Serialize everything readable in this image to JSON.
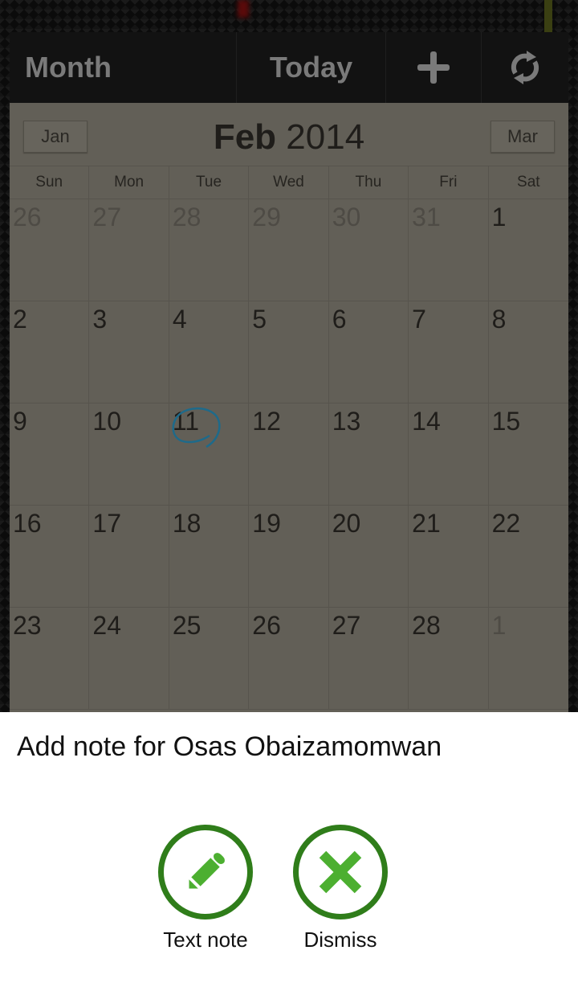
{
  "action_bar": {
    "month_label": "Month",
    "today_label": "Today",
    "add_icon": "plus-icon",
    "sync_icon": "sync-icon"
  },
  "calendar": {
    "prev_month": "Jan",
    "next_month": "Mar",
    "title_month": "Feb",
    "title_year": "2014",
    "weekdays": [
      "Sun",
      "Mon",
      "Tue",
      "Wed",
      "Thu",
      "Fri",
      "Sat"
    ],
    "today": "11",
    "weeks": [
      [
        {
          "d": "26",
          "other": true
        },
        {
          "d": "27",
          "other": true
        },
        {
          "d": "28",
          "other": true
        },
        {
          "d": "29",
          "other": true
        },
        {
          "d": "30",
          "other": true
        },
        {
          "d": "31",
          "other": true
        },
        {
          "d": "1",
          "other": false
        }
      ],
      [
        {
          "d": "2",
          "other": false
        },
        {
          "d": "3",
          "other": false
        },
        {
          "d": "4",
          "other": false
        },
        {
          "d": "5",
          "other": false
        },
        {
          "d": "6",
          "other": false
        },
        {
          "d": "7",
          "other": false
        },
        {
          "d": "8",
          "other": false
        }
      ],
      [
        {
          "d": "9",
          "other": false
        },
        {
          "d": "10",
          "other": false
        },
        {
          "d": "11",
          "other": false
        },
        {
          "d": "12",
          "other": false
        },
        {
          "d": "13",
          "other": false
        },
        {
          "d": "14",
          "other": false
        },
        {
          "d": "15",
          "other": false
        }
      ],
      [
        {
          "d": "16",
          "other": false
        },
        {
          "d": "17",
          "other": false
        },
        {
          "d": "18",
          "other": false
        },
        {
          "d": "19",
          "other": false
        },
        {
          "d": "20",
          "other": false
        },
        {
          "d": "21",
          "other": false
        },
        {
          "d": "22",
          "other": false
        }
      ],
      [
        {
          "d": "23",
          "other": false
        },
        {
          "d": "24",
          "other": false
        },
        {
          "d": "25",
          "other": false
        },
        {
          "d": "26",
          "other": false
        },
        {
          "d": "27",
          "other": false
        },
        {
          "d": "28",
          "other": false
        },
        {
          "d": "1",
          "other": true
        }
      ]
    ],
    "today_ring_color": "#1e6a8a"
  },
  "sheet": {
    "title": "Add note for Osas Obaizamomwan",
    "actions": [
      {
        "label": "Text note",
        "icon": "pencil-icon"
      },
      {
        "label": "Dismiss",
        "icon": "close-icon"
      }
    ],
    "accent_color": "#2f7d1a",
    "icon_fill_color": "#4caf30"
  }
}
